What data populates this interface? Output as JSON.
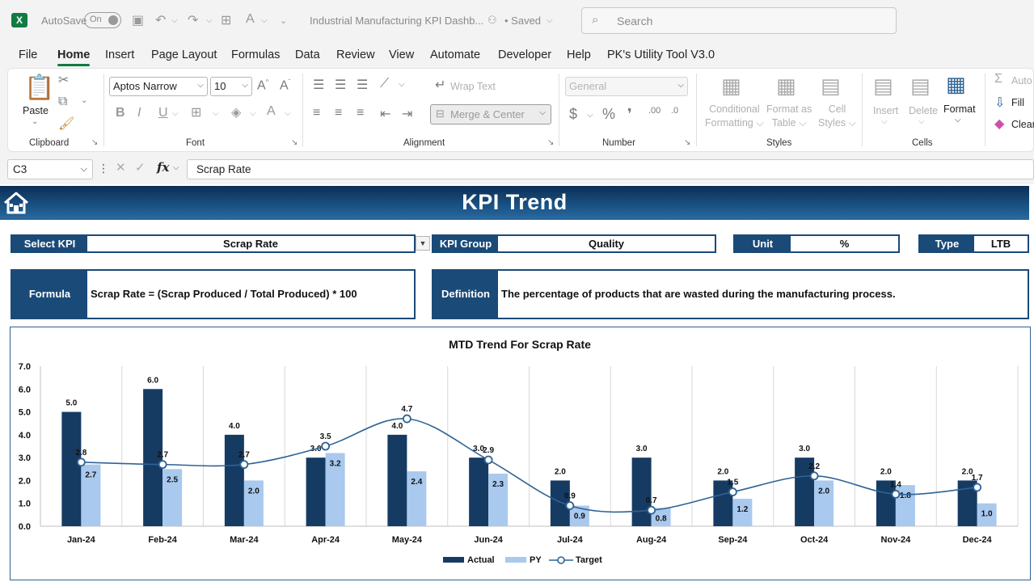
{
  "titlebar": {
    "autosave_label": "AutoSave",
    "autosave_state": "On",
    "document_title": "Industrial Manufacturing KPI Dashb...",
    "saved_status": "• Saved",
    "search_placeholder": "Search"
  },
  "menu": {
    "items": [
      "File",
      "Home",
      "Insert",
      "Page Layout",
      "Formulas",
      "Data",
      "Review",
      "View",
      "Automate",
      "Developer",
      "Help",
      "PK's Utility Tool V3.0"
    ],
    "active": "Home"
  },
  "ribbon": {
    "clipboard": {
      "paste": "Paste",
      "group": "Clipboard"
    },
    "font": {
      "name": "Aptos Narrow",
      "size": "10",
      "group": "Font"
    },
    "alignment": {
      "wrap_text": "Wrap Text",
      "merge_center": "Merge & Center",
      "group": "Alignment"
    },
    "number": {
      "format": "General",
      "group": "Number"
    },
    "styles": {
      "conditional": "Conditional",
      "formatting": "Formatting",
      "format_as": "Format as",
      "table": "Table",
      "cell": "Cell",
      "styles_lbl": "Styles",
      "group": "Styles"
    },
    "cells": {
      "insert": "Insert",
      "delete": "Delete",
      "format": "Format",
      "group": "Cells"
    },
    "editing": {
      "autosum": "Auto",
      "fill": "Fill",
      "clear": "Clear"
    }
  },
  "formula_bar": {
    "name_box": "C3",
    "fx": "fx",
    "content": "Scrap Rate"
  },
  "dashboard": {
    "title": "KPI Trend",
    "select_kpi_label": "Select KPI",
    "select_kpi_value": "Scrap Rate",
    "kpi_group_label": "KPI Group",
    "kpi_group_value": "Quality",
    "unit_label": "Unit",
    "unit_value": "%",
    "type_label": "Type",
    "type_value": "LTB",
    "formula_label": "Formula",
    "formula_value": "Scrap Rate = (Scrap Produced / Total Produced) * 100",
    "definition_label": "Definition",
    "definition_value": "The percentage of products that are wasted during the manufacturing process."
  },
  "colors": {
    "dark_navy": "#1a4a78",
    "actual": "#163b63",
    "py": "#a9c9ee",
    "target": "#2e6395",
    "excel_green": "#107c41"
  },
  "chart_data": {
    "type": "bar",
    "title": "MTD Trend For Scrap Rate",
    "categories": [
      "Jan-24",
      "Feb-24",
      "Mar-24",
      "Apr-24",
      "May-24",
      "Jun-24",
      "Jul-24",
      "Aug-24",
      "Sep-24",
      "Oct-24",
      "Nov-24",
      "Dec-24"
    ],
    "series": [
      {
        "name": "Actual",
        "type": "bar",
        "values": [
          5.0,
          6.0,
          4.0,
          3.0,
          4.0,
          3.0,
          2.0,
          3.0,
          2.0,
          3.0,
          2.0,
          2.0
        ]
      },
      {
        "name": "PY",
        "type": "bar",
        "values": [
          2.7,
          2.5,
          2.0,
          3.2,
          2.4,
          2.3,
          0.9,
          0.8,
          1.2,
          2.0,
          1.8,
          1.0
        ]
      },
      {
        "name": "Target",
        "type": "line",
        "values": [
          2.8,
          2.7,
          2.7,
          3.5,
          4.7,
          2.9,
          0.9,
          0.7,
          1.5,
          2.2,
          1.4,
          1.7
        ]
      }
    ],
    "ylim": [
      0,
      7
    ],
    "yticks": [
      "0.0",
      "1.0",
      "2.0",
      "3.0",
      "4.0",
      "5.0",
      "6.0",
      "7.0"
    ],
    "grid": "vertical",
    "legend": "bottom"
  }
}
